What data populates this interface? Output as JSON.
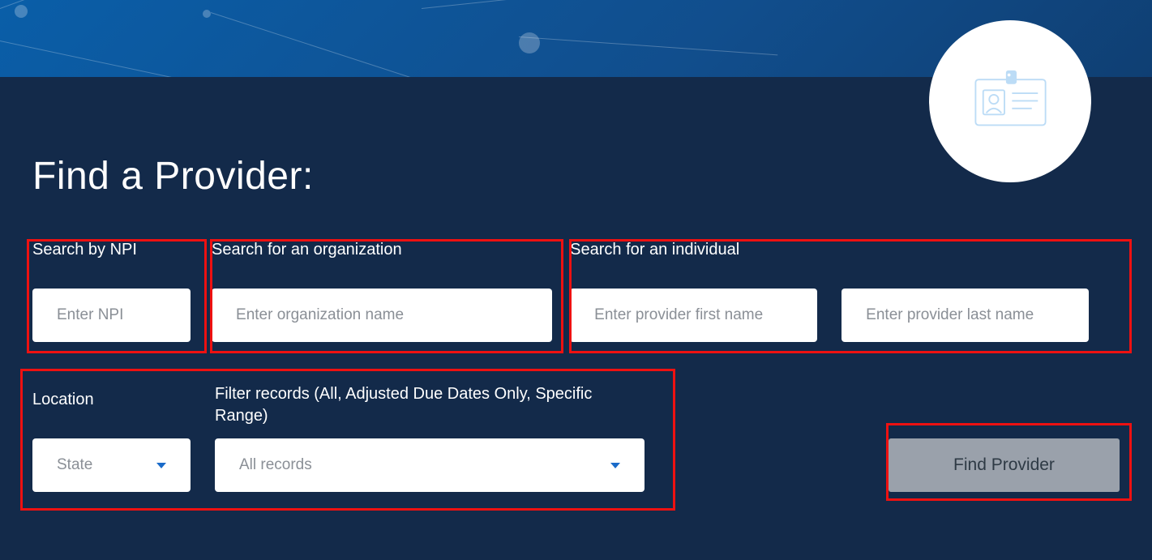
{
  "page": {
    "title": "Find a Provider:"
  },
  "search": {
    "npi": {
      "label": "Search by NPI",
      "placeholder": "Enter NPI",
      "value": ""
    },
    "organization": {
      "label": "Search for an organization",
      "placeholder": "Enter organization name",
      "value": ""
    },
    "individual": {
      "label": "Search for an individual",
      "first_name_placeholder": "Enter provider first name",
      "first_name_value": "",
      "last_name_placeholder": "Enter provider last name",
      "last_name_value": ""
    },
    "location": {
      "label": "Location",
      "selected": "State"
    },
    "filter": {
      "label": "Filter records (All, Adjusted Due Dates Only, Specific Range)",
      "selected": "All records"
    },
    "submit_label": "Find Provider"
  },
  "icons": {
    "badge": "id-badge-icon",
    "caret": "chevron-down-icon"
  },
  "colors": {
    "panel_bg": "#132a4a",
    "banner_start": "#0a5ea8",
    "banner_end": "#0f3f73",
    "accent": "#1a6bc9",
    "highlight": "#e11",
    "button_bg": "#9aa1ab"
  }
}
